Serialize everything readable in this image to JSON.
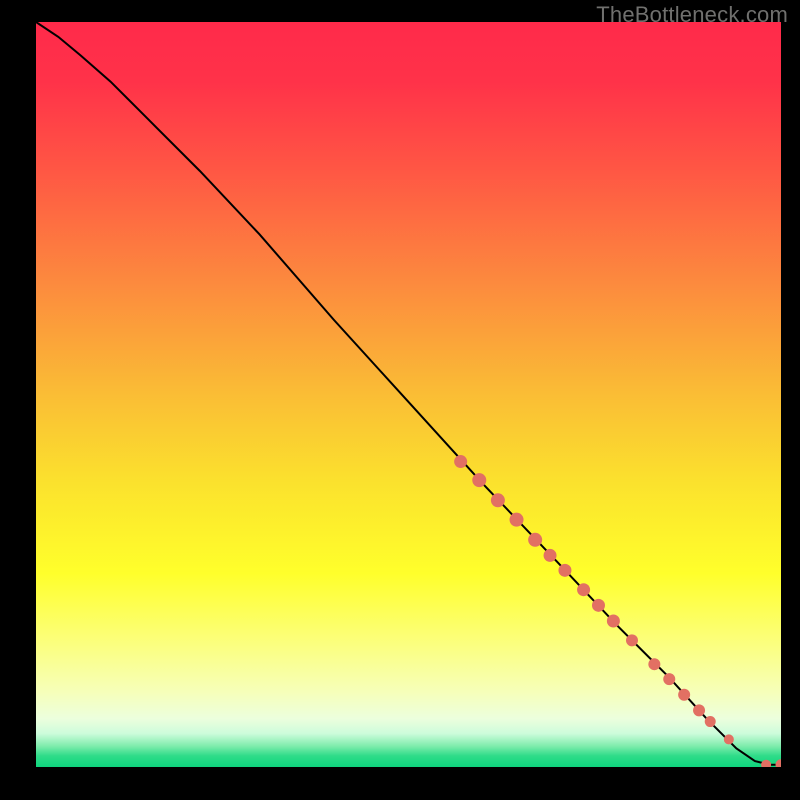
{
  "watermark": "TheBottleneck.com",
  "colors": {
    "background": "#000000",
    "curve_stroke": "#000000",
    "marker_fill": "#e27063",
    "gradient_stops": [
      {
        "offset": 0.0,
        "color": "#ff2a4a"
      },
      {
        "offset": 0.08,
        "color": "#ff3249"
      },
      {
        "offset": 0.2,
        "color": "#ff5744"
      },
      {
        "offset": 0.35,
        "color": "#fc8a3e"
      },
      {
        "offset": 0.5,
        "color": "#fabd35"
      },
      {
        "offset": 0.62,
        "color": "#fbe22d"
      },
      {
        "offset": 0.74,
        "color": "#ffff2b"
      },
      {
        "offset": 0.84,
        "color": "#fbff83"
      },
      {
        "offset": 0.9,
        "color": "#f6ffba"
      },
      {
        "offset": 0.935,
        "color": "#ecffdd"
      },
      {
        "offset": 0.955,
        "color": "#cdfcdb"
      },
      {
        "offset": 0.972,
        "color": "#7eecac"
      },
      {
        "offset": 0.985,
        "color": "#2fdc89"
      },
      {
        "offset": 1.0,
        "color": "#0ed57e"
      }
    ]
  },
  "chart_data": {
    "type": "line",
    "title": "",
    "xlabel": "",
    "ylabel": "",
    "xlim": [
      0,
      100
    ],
    "ylim": [
      0,
      100
    ],
    "series": [
      {
        "name": "curve",
        "x": [
          0,
          3,
          6,
          10,
          15,
          22,
          30,
          40,
          50,
          60,
          70,
          78,
          85,
          90,
          94,
          96.5,
          98.5,
          100
        ],
        "y": [
          100,
          98,
          95.5,
          92,
          87,
          80,
          71.5,
          60,
          49,
          38,
          27.5,
          19,
          12,
          6.5,
          2.5,
          0.8,
          0.3,
          0.3
        ]
      }
    ],
    "markers": {
      "name": "points-on-curve",
      "points": [
        {
          "x": 57,
          "y": 41,
          "r": 6.5
        },
        {
          "x": 59.5,
          "y": 38.5,
          "r": 7
        },
        {
          "x": 62,
          "y": 35.8,
          "r": 7
        },
        {
          "x": 64.5,
          "y": 33.2,
          "r": 7
        },
        {
          "x": 67,
          "y": 30.5,
          "r": 7
        },
        {
          "x": 69,
          "y": 28.4,
          "r": 6.5
        },
        {
          "x": 71,
          "y": 26.4,
          "r": 6.5
        },
        {
          "x": 73.5,
          "y": 23.8,
          "r": 6.5
        },
        {
          "x": 75.5,
          "y": 21.7,
          "r": 6.5
        },
        {
          "x": 77.5,
          "y": 19.6,
          "r": 6.5
        },
        {
          "x": 80,
          "y": 17,
          "r": 6
        },
        {
          "x": 83,
          "y": 13.8,
          "r": 6
        },
        {
          "x": 85,
          "y": 11.8,
          "r": 6
        },
        {
          "x": 87,
          "y": 9.7,
          "r": 6
        },
        {
          "x": 89,
          "y": 7.6,
          "r": 6
        },
        {
          "x": 90.5,
          "y": 6.1,
          "r": 5.5
        },
        {
          "x": 93,
          "y": 3.7,
          "r": 5
        },
        {
          "x": 98,
          "y": 0.3,
          "r": 5
        },
        {
          "x": 100,
          "y": 0.3,
          "r": 5.5
        }
      ]
    }
  }
}
